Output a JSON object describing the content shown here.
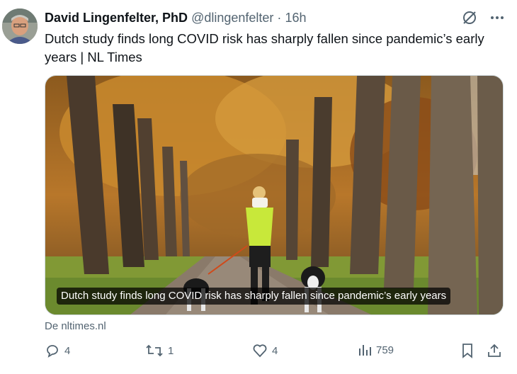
{
  "post": {
    "author_name": "David Lingenfelter, PhD",
    "author_handle": "@dlingenfelter",
    "separator": "·",
    "timestamp": "16h",
    "text": "Dutch study finds long COVID risk has sharply fallen since pandemic’s early years | NL Times",
    "avatar_icon": "avatar-photo"
  },
  "link_card": {
    "caption": "Dutch study finds long COVID risk has sharply fallen since pandemic’s early years",
    "source": "De nltimes.nl",
    "image_subject": "tree-lined-path-with-runner-and-dogs"
  },
  "actions": {
    "replies": "4",
    "reposts": "1",
    "likes": "4",
    "views": "759"
  },
  "colors": {
    "text": "#0f1419",
    "secondary": "#536471",
    "border": "#cfd9de"
  }
}
